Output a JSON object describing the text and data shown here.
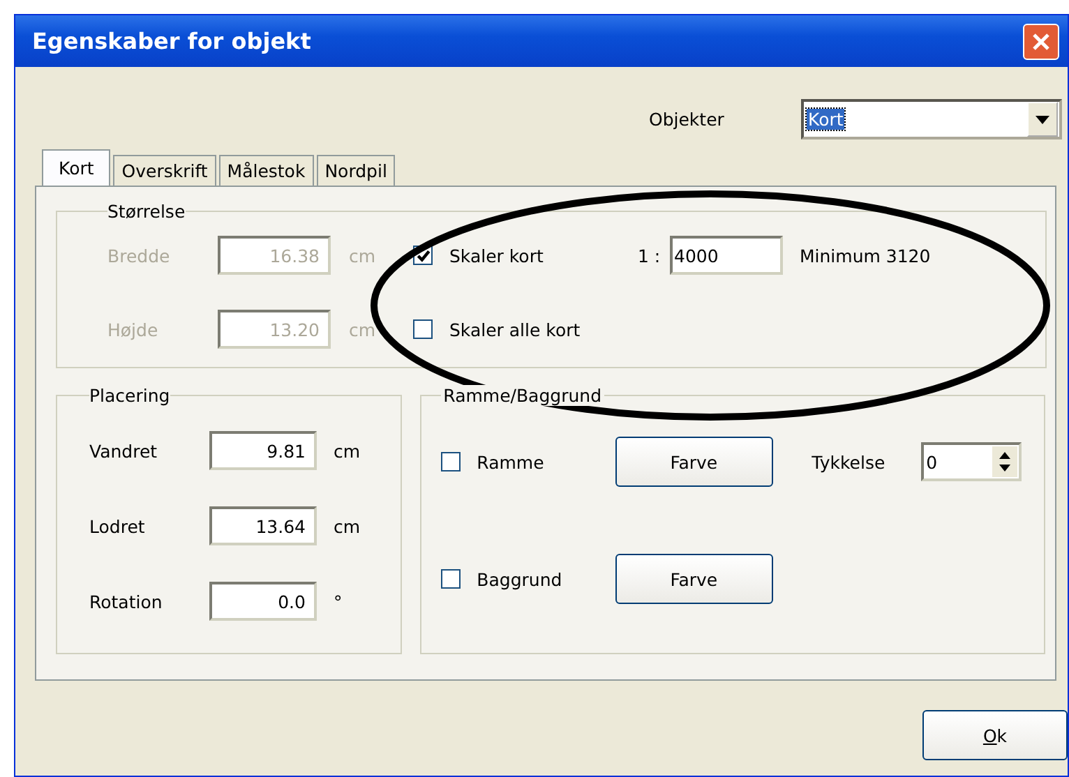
{
  "window": {
    "title": "Egenskaber for objekt"
  },
  "objects": {
    "label": "Objekter",
    "value": "Kort"
  },
  "tabs": [
    {
      "label": "Kort",
      "selected": true
    },
    {
      "label": "Overskrift",
      "selected": false
    },
    {
      "label": "Målestok",
      "selected": false
    },
    {
      "label": "Nordpil",
      "selected": false
    }
  ],
  "size_group": {
    "title": "Størrelse",
    "fields": [
      {
        "label": "Bredde",
        "value": "16.38",
        "unit": "cm",
        "disabled": true
      },
      {
        "label": "Højde",
        "value": "13.20",
        "unit": "cm",
        "disabled": true
      }
    ],
    "scale": {
      "label": "Skaler kort",
      "checked": true,
      "prefix": "1 :",
      "value": "4000",
      "note": "Minimum 3120"
    },
    "scale_all": {
      "label": "Skaler alle kort",
      "checked": false
    }
  },
  "placement": {
    "title": "Placering",
    "fields": [
      {
        "label": "Vandret",
        "value": "9.81",
        "unit": "cm"
      },
      {
        "label": "Lodret",
        "value": "13.64",
        "unit": "cm"
      },
      {
        "label": "Rotation",
        "value": "0.0",
        "unit": "°"
      }
    ]
  },
  "frame": {
    "title": "Ramme/Baggrund",
    "rows": [
      {
        "label": "Ramme",
        "checked": false,
        "button": "Farve"
      },
      {
        "label": "Baggrund",
        "checked": false,
        "button": "Farve"
      }
    ],
    "thickness": {
      "label": "Tykkelse",
      "value": "0"
    }
  },
  "ok_button": {
    "label": "Ok"
  }
}
